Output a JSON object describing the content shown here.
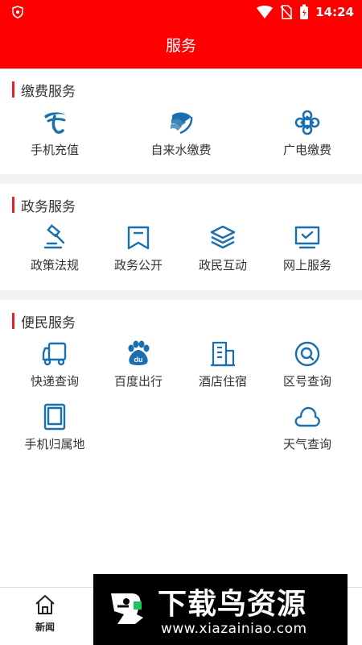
{
  "status_bar": {
    "time": "14:24"
  },
  "header": {
    "title": "服务"
  },
  "sections": [
    {
      "title": "缴费服务",
      "items": [
        {
          "label": "手机充值",
          "icon": "china-telecom-icon"
        },
        {
          "label": "自来水缴费",
          "icon": "china-mobile-icon"
        },
        {
          "label": "广电缴费",
          "icon": "china-unicom-icon"
        }
      ]
    },
    {
      "title": "政务服务",
      "items": [
        {
          "label": "政策法规",
          "icon": "gavel-icon"
        },
        {
          "label": "政务公开",
          "icon": "bookmark-icon"
        },
        {
          "label": "政民互动",
          "icon": "layers-icon"
        },
        {
          "label": "网上服务",
          "icon": "monitor-check-icon"
        }
      ]
    },
    {
      "title": "便民服务",
      "items": [
        {
          "label": "快递查询",
          "icon": "truck-icon"
        },
        {
          "label": "百度出行",
          "icon": "baidu-paw-icon"
        },
        {
          "label": "酒店住宿",
          "icon": "building-icon"
        },
        {
          "label": "区号查询",
          "icon": "search-circle-icon"
        },
        {
          "label": "手机归属地",
          "icon": "tablet-icon"
        },
        {
          "label": "天气查询",
          "icon": "cloud-icon"
        }
      ]
    }
  ],
  "bottom_nav": {
    "items": [
      {
        "label": "新闻",
        "icon": "home-icon"
      }
    ]
  },
  "watermark": {
    "title": "下载鸟资源",
    "url": "www.xiazainiao.com"
  },
  "colors": {
    "accent": "#ff0000",
    "icon": "#1a6fae",
    "divider": "#f2f2f2"
  }
}
